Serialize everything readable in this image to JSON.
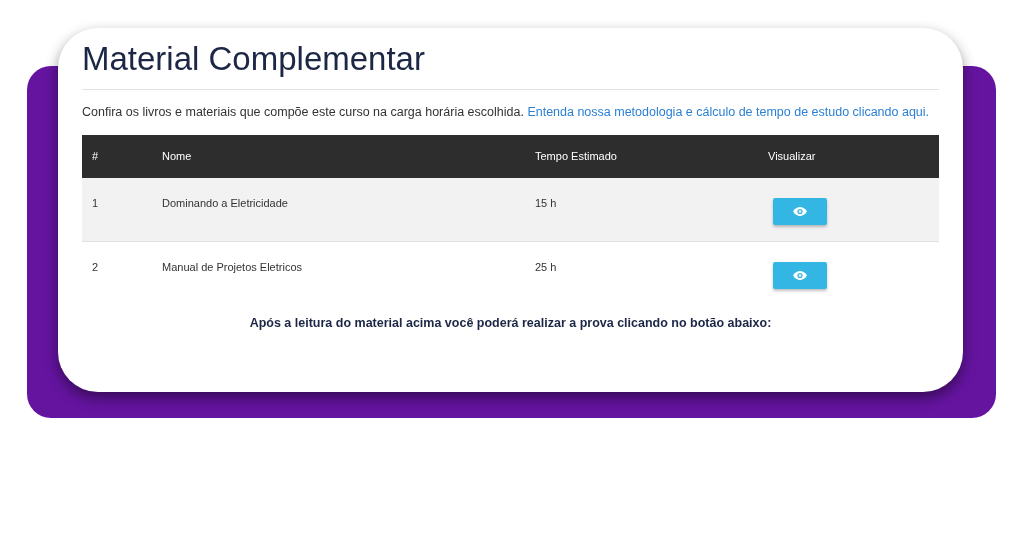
{
  "title": "Material Complementar",
  "intro": {
    "text": "Confira os livros e materiais que compõe este curso na carga horária escolhida.",
    "link": "Entenda nossa metodologia e cálculo de tempo de estudo clicando aqui."
  },
  "table": {
    "columns": [
      "#",
      "Nome",
      "Tempo Estimado",
      "Visualizar"
    ],
    "rows": [
      {
        "number": "1",
        "name": "Dominando a Eletricidade",
        "time": "15 h"
      },
      {
        "number": "2",
        "name": "Manual de Projetos Eletricos",
        "time": "25 h"
      }
    ]
  },
  "footer_note": "Após a leitura do material acima você poderá realizar a prova clicando no botão abaixo:"
}
